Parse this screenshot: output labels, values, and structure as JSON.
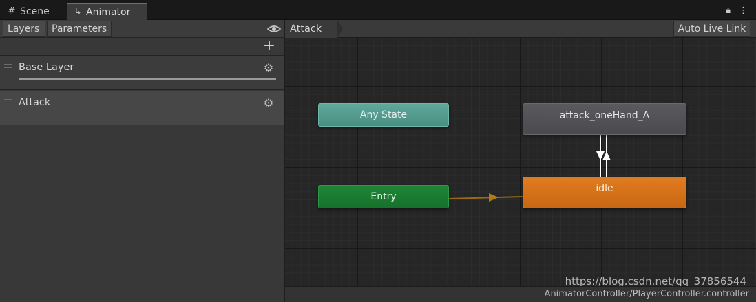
{
  "tabs": [
    {
      "label": "Scene",
      "icon": "grid-icon"
    },
    {
      "label": "Animator",
      "icon": "animator-icon"
    }
  ],
  "left_panel": {
    "tabs": [
      "Layers",
      "Parameters"
    ],
    "layers": [
      {
        "name": "Base Layer",
        "weight": 1.0
      },
      {
        "name": "Attack"
      }
    ]
  },
  "graph": {
    "breadcrumb": "Attack",
    "auto_live_link": "Auto Live Link",
    "states": {
      "any_state": "Any State",
      "entry": "Entry",
      "attack": "attack_oneHand_A",
      "idle": "idle"
    },
    "asset_path": "AnimatorController/PlayerController.controller",
    "watermark": "https://blog.csdn.net/qq_37856544"
  },
  "colors": {
    "tab_accent": "#3a79bb",
    "any_state": "#5aa195",
    "entry": "#1c7e32",
    "default_state": "#d8741b",
    "state": "#545458",
    "transition_default": "#9a6a18",
    "transition": "#ffffff"
  }
}
